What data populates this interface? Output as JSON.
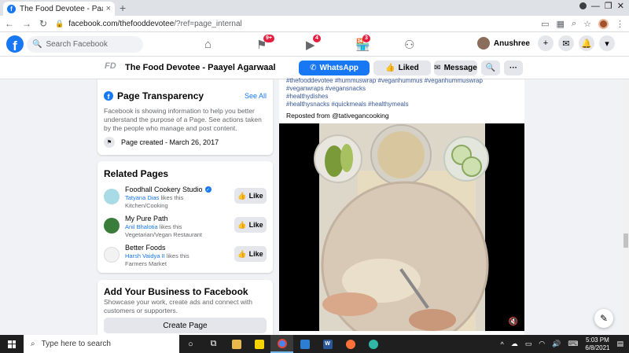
{
  "browser": {
    "tab_title": "The Food Devotee - Paayel Agar",
    "tab_close": "×",
    "new_tab": "+",
    "url_host": "facebook.com/thefooddevotee",
    "url_path": "/?ref=page_internal"
  },
  "fbnav": {
    "search_placeholder": "Search Facebook",
    "badges": {
      "pages": "9+",
      "watch": "4",
      "marketplace": "3"
    },
    "user_name": "Anushree"
  },
  "page_header": {
    "logo_text": "FD",
    "page_name": "The Food Devotee - Paayel Agarwaal",
    "whatsapp_label": "WhatsApp",
    "liked_label": "Liked",
    "message_label": "Message"
  },
  "transparency": {
    "title": "Page Transparency",
    "see_all": "See All",
    "description": "Facebook is showing information to help you better understand the purpose of a Page. See actions taken by the people who manage and post content.",
    "created": "Page created - March 26, 2017"
  },
  "related": {
    "title": "Related Pages",
    "like_label": "Like",
    "items": [
      {
        "name": "Foodhall Cookery Studio",
        "liker": "Tatyana Dias",
        "suffix": "likes this",
        "category": "Kitchen/Cooking",
        "color": "#a8dbe6"
      },
      {
        "name": "My Pure Path",
        "liker": "Anil Bhalotia",
        "suffix": "likes this",
        "category": "Vegetarian/Vegan Restaurant",
        "color": "#3a7d3a"
      },
      {
        "name": "Better Foods",
        "liker": "Harsh Vaidya II",
        "suffix": "likes this",
        "category": "Farmers Market",
        "color": "#f2f2f2"
      }
    ]
  },
  "business": {
    "title": "Add Your Business to Facebook",
    "description": "Showcase your work, create ads and connect with customers or supporters.",
    "create_label": "Create Page"
  },
  "post": {
    "hashtags_line1": "#thefooddevotee #hummuswrap #veganhummus #veganhummuswrap",
    "hashtags_line2": "#veganwraps #vegansnacks",
    "hashtags_line3": "#healthydishes",
    "hashtags_line4": "#healthysnacks #quickmeals #healthymeals",
    "repost_prefix": "Reposted from",
    "repost_handle": "@tativegancooking"
  },
  "taskbar": {
    "search_placeholder": "Type here to search",
    "time": "5:03 PM",
    "date": "6/8/2021"
  }
}
